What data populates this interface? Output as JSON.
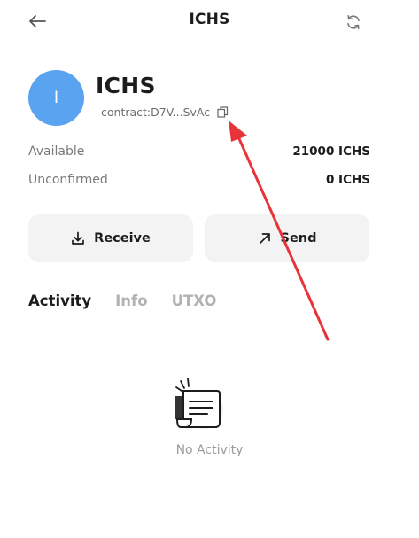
{
  "header": {
    "title": "ICHS",
    "back_icon": "arrow-left-icon",
    "refresh_icon": "refresh-icon"
  },
  "token": {
    "avatar_letter": "I",
    "name": "ICHS",
    "contract": "contract:D7V...SvAc",
    "avatar_color": "#5aa3f0"
  },
  "stats": [
    {
      "label": "Available",
      "value": "21000 ICHS"
    },
    {
      "label": "Unconfirmed",
      "value": "0 ICHS"
    }
  ],
  "actions": {
    "receive_label": "Receive",
    "send_label": "Send"
  },
  "tabs": [
    {
      "label": "Activity",
      "active": true
    },
    {
      "label": "Info",
      "active": false
    },
    {
      "label": "UTXO",
      "active": false
    }
  ],
  "empty_state": {
    "text": "No Activity",
    "icon": "empty-document-icon"
  },
  "colors": {
    "accent": "#5aa3f0",
    "annotation": "#e8333a",
    "button_bg": "#f3f3f3"
  }
}
